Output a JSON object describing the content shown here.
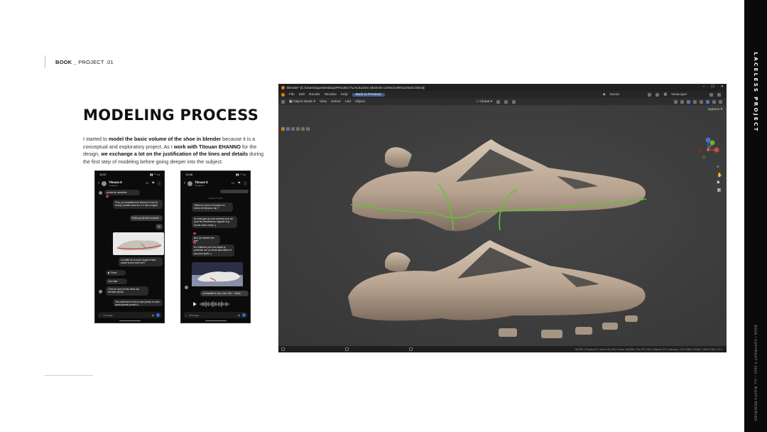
{
  "header": {
    "book": "BOOK _",
    "project": "PROJECT .01"
  },
  "title": "MODELING PROCESS",
  "intro": {
    "t1": "I started to ",
    "b1": "model the basic volume of the shoe in blender",
    "t2": " because it is a conceptual and exploratory project. As I ",
    "b2": "work with Titouan EHANNO",
    "t3": " for the design, ",
    "b3": "we exchange a lot on the justification of the lines and details",
    "t4": " during the first step of modeling before going deeper into the subject."
  },
  "side_band": {
    "title": "LACELESS PROJECT",
    "copyright": "BOOK • COPYRIGHT © 2022 – ALL RIGHTS RESERVED"
  },
  "phone1": {
    "time": "10:57",
    "contact": "Titouan E",
    "contact_sub": "Instagram",
    "messages": [
      "portes de semelles",
      "Pour ça complètement d'accord c'est ok dont je parlais dans les 2, il faut à régler",
      "Enfin ça j'ai bien compris",
      "ok",
      "La reflet de la zone rouge le faire suivre tout le trait vert?",
      "Photo",
      "Oui voila",
      "C'est ce que j'ai mis dans ma dernière photo",
      "Yes carrément c'est ce que j'avais lu mais après jamais pensé à..."
    ],
    "input_placeholder": "Message..."
  },
  "phone2": {
    "time": "10:58",
    "contact": "Titouan E",
    "contact_sub": "Instagram",
    "date_label": "9 AVR. À 12:11",
    "messages": [
      "Tellées tu peux m'envoyer un rendu de dessous stp ?",
      "Au final gars je suis vraiment pas sûr pour les brancilles je regarde si je trouve autre chose ;)",
      "Bon j'ai décidé d'en trier",
      "En d'ailleurs pour les laçets je parlerais sur un dème spéculaire et pas plus épais ;)",
      "Je travaille le soir, cher 19h ~ 40min"
    ],
    "input_placeholder": "Message..."
  },
  "blender": {
    "window_title": "Blender* [C:\\Users\\dupo\\Desktop\\PROJECT\\LACELESS DESIGN CONCOURS\\LD\\03\\2.blend]",
    "menus": [
      "File",
      "Edit",
      "Render",
      "Window",
      "Help"
    ],
    "back_button": "Back to Previous",
    "scene": "Scene",
    "view_layer": "ViewLayer",
    "mode": "Object Mode",
    "tool_menus": [
      "View",
      "Select",
      "Add",
      "Object"
    ],
    "orientation": "Global",
    "options": "Options",
    "status": "MUSEL | Empty 0/1 | Verts 146,734 | Faces 148,886 | Tris 297,782 | Objects 0/11 | Memory: 752.3 MiB | VRAM: 1.6/6.0 GiB | 2.9.1",
    "gizmo_axes": [
      "X",
      "Y",
      "Z"
    ]
  }
}
